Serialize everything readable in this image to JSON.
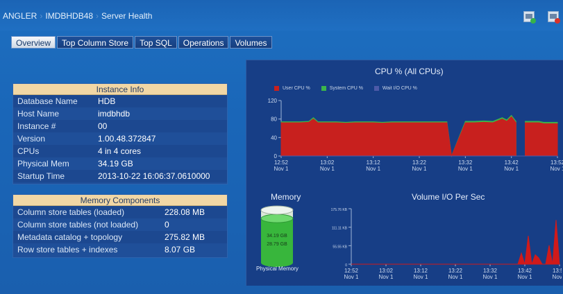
{
  "header": {
    "breadcrumb": [
      "ANGLER",
      "IMDBHDB48",
      "Server Health"
    ]
  },
  "tabs": [
    {
      "label": "Overview",
      "active": true
    },
    {
      "label": "Top Column Store",
      "active": false
    },
    {
      "label": "Top SQL",
      "active": false
    },
    {
      "label": "Operations",
      "active": false
    },
    {
      "label": "Volumes",
      "active": false
    }
  ],
  "instance_info": {
    "title": "Instance Info",
    "rows": [
      {
        "key": "Database Name",
        "value": "HDB"
      },
      {
        "key": "Host Name",
        "value": "imdbhdb"
      },
      {
        "key": "Instance #",
        "value": "00"
      },
      {
        "key": "Version",
        "value": "1.00.48.372847"
      },
      {
        "key": "CPUs",
        "value": "4 in 4 cores"
      },
      {
        "key": "Physical Mem",
        "value": "34.19 GB"
      },
      {
        "key": "Startup Time",
        "value": "2013-10-22 16:06:37.0610000"
      }
    ]
  },
  "memory_components": {
    "title": "Memory Components",
    "rows": [
      {
        "key": "Column store tables (loaded)",
        "value": "228.08 MB"
      },
      {
        "key": "Column store tables (not loaded)",
        "value": "0"
      },
      {
        "key": "Metadata catalog + topology",
        "value": "275.82 MB"
      },
      {
        "key": "Row store tables + indexes",
        "value": "8.07 GB"
      }
    ]
  },
  "memory_widget": {
    "title": "Memory",
    "total": "34.19 GB",
    "used": "28.79 GB",
    "used_fraction": 0.84,
    "caption": "Physical Memory",
    "colors": {
      "body": "#dbe8d9",
      "fill": "#38b63c"
    }
  },
  "icons": {
    "toolbar": [
      "export-icon",
      "delete-icon"
    ]
  },
  "chart_data": [
    {
      "type": "area",
      "title": "CPU % (All CPUs)",
      "xlabel": "",
      "ylabel": "",
      "ylim": [
        0,
        120
      ],
      "y_ticks": [
        "0",
        "40",
        "80",
        "120"
      ],
      "x_ticks": [
        {
          "time": "12:52",
          "date": "Nov 1"
        },
        {
          "time": "13:02",
          "date": "Nov 1"
        },
        {
          "time": "13:12",
          "date": "Nov 1"
        },
        {
          "time": "13:22",
          "date": "Nov 1"
        },
        {
          "time": "13:32",
          "date": "Nov 1"
        },
        {
          "time": "13:42",
          "date": "Nov 1"
        },
        {
          "time": "13:52",
          "date": "Nov 1"
        }
      ],
      "x_range": [
        0,
        60
      ],
      "series": [
        {
          "name": "User CPU %",
          "color": "#c8201e",
          "x": [
            0,
            2,
            4,
            6,
            7,
            8,
            9,
            10,
            12,
            14,
            16,
            18,
            20,
            22,
            24,
            26,
            28,
            30,
            32,
            34,
            36,
            37,
            40,
            42,
            44,
            46,
            48,
            49,
            50,
            51,
            52,
            53,
            56,
            57,
            59,
            60
          ],
          "y": [
            72,
            72,
            72,
            73,
            80,
            72,
            72,
            72,
            72,
            71,
            72,
            72,
            72,
            71,
            72,
            72,
            72,
            72,
            72,
            72,
            72,
            0,
            72,
            72,
            73,
            72,
            80,
            75,
            85,
            72,
            null,
            72,
            72,
            70,
            70,
            70
          ]
        },
        {
          "name": "System CPU %",
          "color": "#3bb54a",
          "x": [
            0,
            2,
            4,
            6,
            7,
            8,
            9,
            10,
            12,
            14,
            16,
            18,
            20,
            22,
            24,
            26,
            28,
            30,
            32,
            34,
            36,
            37,
            40,
            42,
            44,
            46,
            48,
            49,
            50,
            51,
            52,
            53,
            56,
            57,
            59,
            60
          ],
          "y": [
            2,
            2,
            2,
            2,
            3,
            2,
            2,
            2,
            2,
            2,
            2,
            2,
            2,
            2,
            2,
            2,
            2,
            2,
            2,
            2,
            2,
            0,
            3,
            3,
            3,
            3,
            3,
            3,
            3,
            3,
            null,
            3,
            3,
            3,
            3,
            3
          ]
        },
        {
          "name": "Wait I/O CPU %",
          "color": "#4d5aa8",
          "x": [
            0,
            60
          ],
          "y": [
            0,
            0
          ]
        }
      ]
    },
    {
      "type": "area",
      "title": "Volume I/O Per Sec",
      "xlabel": "",
      "ylabel": "",
      "ylim": [
        0,
        175.76
      ],
      "y_ticks": [
        "0",
        "55.55 KB",
        "111.11 KB",
        "175.76 KB"
      ],
      "x_ticks": [
        {
          "time": "12:52",
          "date": "Nov 1"
        },
        {
          "time": "13:02",
          "date": "Nov 1"
        },
        {
          "time": "13:12",
          "date": "Nov 1"
        },
        {
          "time": "13:22",
          "date": "Nov 1"
        },
        {
          "time": "13:32",
          "date": "Nov 1"
        },
        {
          "time": "13:42",
          "date": "Nov 1"
        },
        {
          "time": "13:52",
          "date": "Nov 1"
        }
      ],
      "x_range": [
        0,
        60
      ],
      "series": [
        {
          "name": "Volume I/O",
          "color": "#d01a1a",
          "x": [
            0,
            48,
            49,
            50,
            51,
            52,
            53,
            54,
            55,
            56,
            57,
            58,
            59,
            60
          ],
          "y": [
            0,
            0,
            35,
            0,
            90,
            0,
            30,
            20,
            0,
            0,
            60,
            0,
            140,
            0
          ]
        }
      ]
    }
  ]
}
